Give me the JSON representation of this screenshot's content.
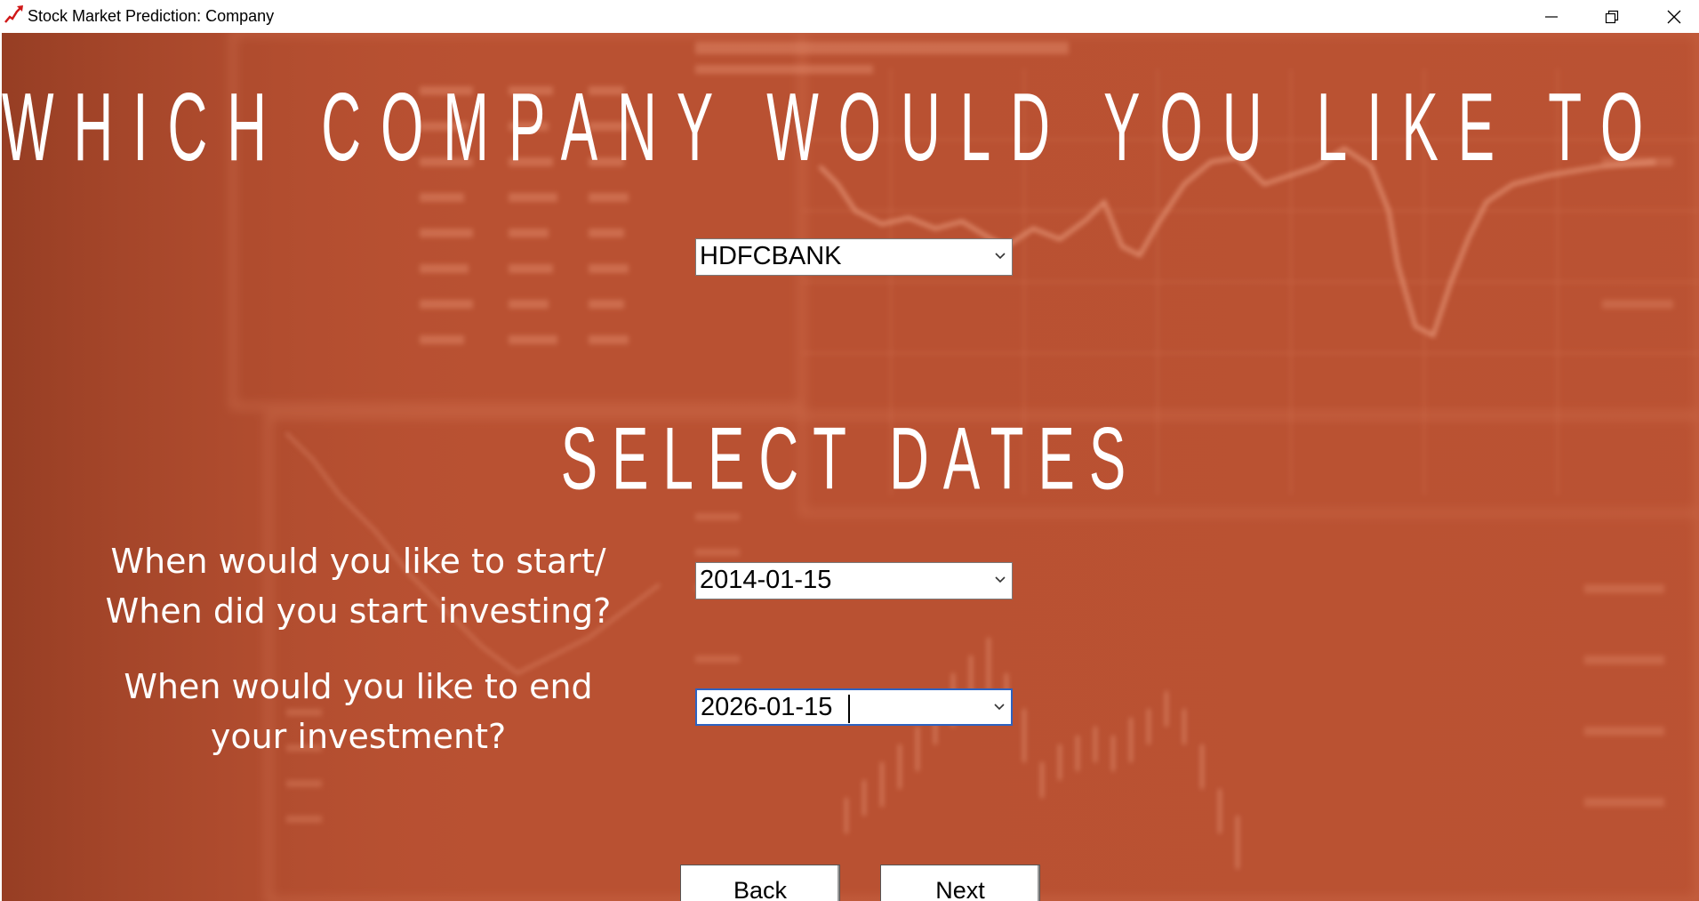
{
  "window": {
    "title": "Stock Market Prediction: Company",
    "app_icon": "stock-chart-icon",
    "controls": [
      "minimize-icon",
      "restore-icon",
      "close-icon"
    ]
  },
  "main": {
    "heading": "WHICH COMPANY WOULD YOU LIKE TO INVEST IN?",
    "company_select": {
      "value": "HDFCBANK"
    },
    "dates_heading": "SELECT DATES",
    "start_prompt_line1": "When would you like to start/",
    "start_prompt_line2": "When did you start investing?",
    "start_date_select": {
      "value": "2014-01-15"
    },
    "end_prompt_line1": "When would you like to end",
    "end_prompt_line2": "your investment?",
    "end_date_select": {
      "value": "2026-01-15"
    },
    "back_label": "Back",
    "next_label": "Next"
  },
  "colors": {
    "background_tint": "#b95132",
    "text": "#ffffff",
    "focus_border": "#2d62c0"
  }
}
